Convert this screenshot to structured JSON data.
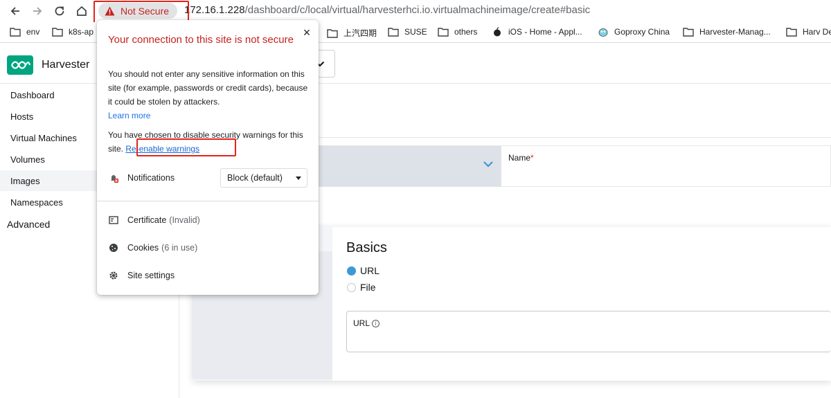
{
  "browser": {
    "security_chip": "Not Secure",
    "url_host": "172.16.1.228",
    "url_path": "/dashboard/c/local/virtual/harvesterhci.io.virtualmachineimage/create#basic"
  },
  "bookmarks": [
    {
      "label": "env",
      "icon": "folder-icon"
    },
    {
      "label": "k8s-ap",
      "icon": "folder-icon"
    },
    {
      "label": "上汽四期",
      "icon": "folder-icon"
    },
    {
      "label": "SUSE",
      "icon": "folder-icon"
    },
    {
      "label": "others",
      "icon": "folder-icon"
    },
    {
      "label": "iOS - Home - Appl...",
      "icon": "apple-icon"
    },
    {
      "label": "Goproxy China",
      "icon": "gopher-icon"
    },
    {
      "label": "Harvester-Manag...",
      "icon": "folder-icon"
    },
    {
      "label": "Harv De",
      "icon": "folder-icon"
    }
  ],
  "app": {
    "brand": "Harvester"
  },
  "sidebar": {
    "items": [
      {
        "label": "Dashboard"
      },
      {
        "label": "Hosts"
      },
      {
        "label": "Virtual Machines"
      },
      {
        "label": "Volumes"
      },
      {
        "label": "Images"
      },
      {
        "label": "Namespaces"
      }
    ],
    "group": "Advanced"
  },
  "form": {
    "name_label": "Name",
    "required_mark": "*",
    "section_title": "Basics",
    "radio_url": "URL",
    "radio_file": "File",
    "url_field_label": "URL"
  },
  "popup": {
    "title": "Your connection to this site is not secure",
    "close": "×",
    "warning_text": "You should not enter any sensitive information on this site (for example, passwords or credit cards), because it could be stolen by attackers.",
    "learn_more": "Learn more",
    "disabled_text": "You have chosen to disable security warnings for this site.",
    "reenable": "Re-enable warnings",
    "notifications_label": "Notifications",
    "notifications_value": "Block (default)",
    "certificate_label": "Certificate",
    "certificate_status": "(Invalid)",
    "cookies_label": "Cookies",
    "cookies_status": "(6 in use)",
    "site_settings": "Site settings"
  }
}
